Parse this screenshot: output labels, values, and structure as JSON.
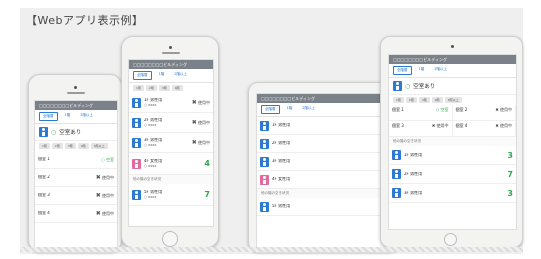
{
  "page_title": "【Webアプリ表示例】",
  "app": {
    "header_title": "□□□□□□□□ビルディング"
  },
  "tabs": [
    "全階層",
    "1階",
    "2階以上"
  ],
  "chips": [
    "1階",
    "2階",
    "3階",
    "4階",
    "5階以上"
  ],
  "vacancy_label": "空室あり",
  "status": {
    "ok": "空室",
    "busy": "使用中",
    "x": "✖"
  },
  "rows": [
    {
      "name": "1F 男性用",
      "sub": "○ xxxx",
      "status": "busy"
    },
    {
      "name": "2F 男性用",
      "sub": "○ xxxx",
      "status": "busy"
    },
    {
      "name": "3F 男性用",
      "sub": "○ xxxx",
      "status": "busy"
    },
    {
      "name": "4F 女性用",
      "sub": "○ xxxx",
      "status": "count",
      "count": "4"
    },
    {
      "name": "5F 男性用",
      "sub": "○ xxxx",
      "status": "count",
      "count": "7"
    }
  ],
  "left_phone_rows": [
    {
      "name": "個室 1",
      "status": "ok"
    },
    {
      "name": "個室 2",
      "status": "busy"
    },
    {
      "name": "個室 3",
      "status": "busy"
    },
    {
      "name": "個室 4",
      "status": "busy"
    }
  ],
  "tablet_grid": [
    {
      "name": "個室 1",
      "status": "ok"
    },
    {
      "name": "個室 2",
      "status": "busy"
    },
    {
      "name": "個室 3",
      "status": "busy"
    },
    {
      "name": "個室 4",
      "status": "busy"
    }
  ],
  "tablet_rows": [
    {
      "name": "1F 男性用",
      "count": "3"
    },
    {
      "name": "2F 男性用",
      "count": "7"
    },
    {
      "name": "3F 男性用",
      "count": "3"
    }
  ],
  "section_label": "他の階の空き状況"
}
